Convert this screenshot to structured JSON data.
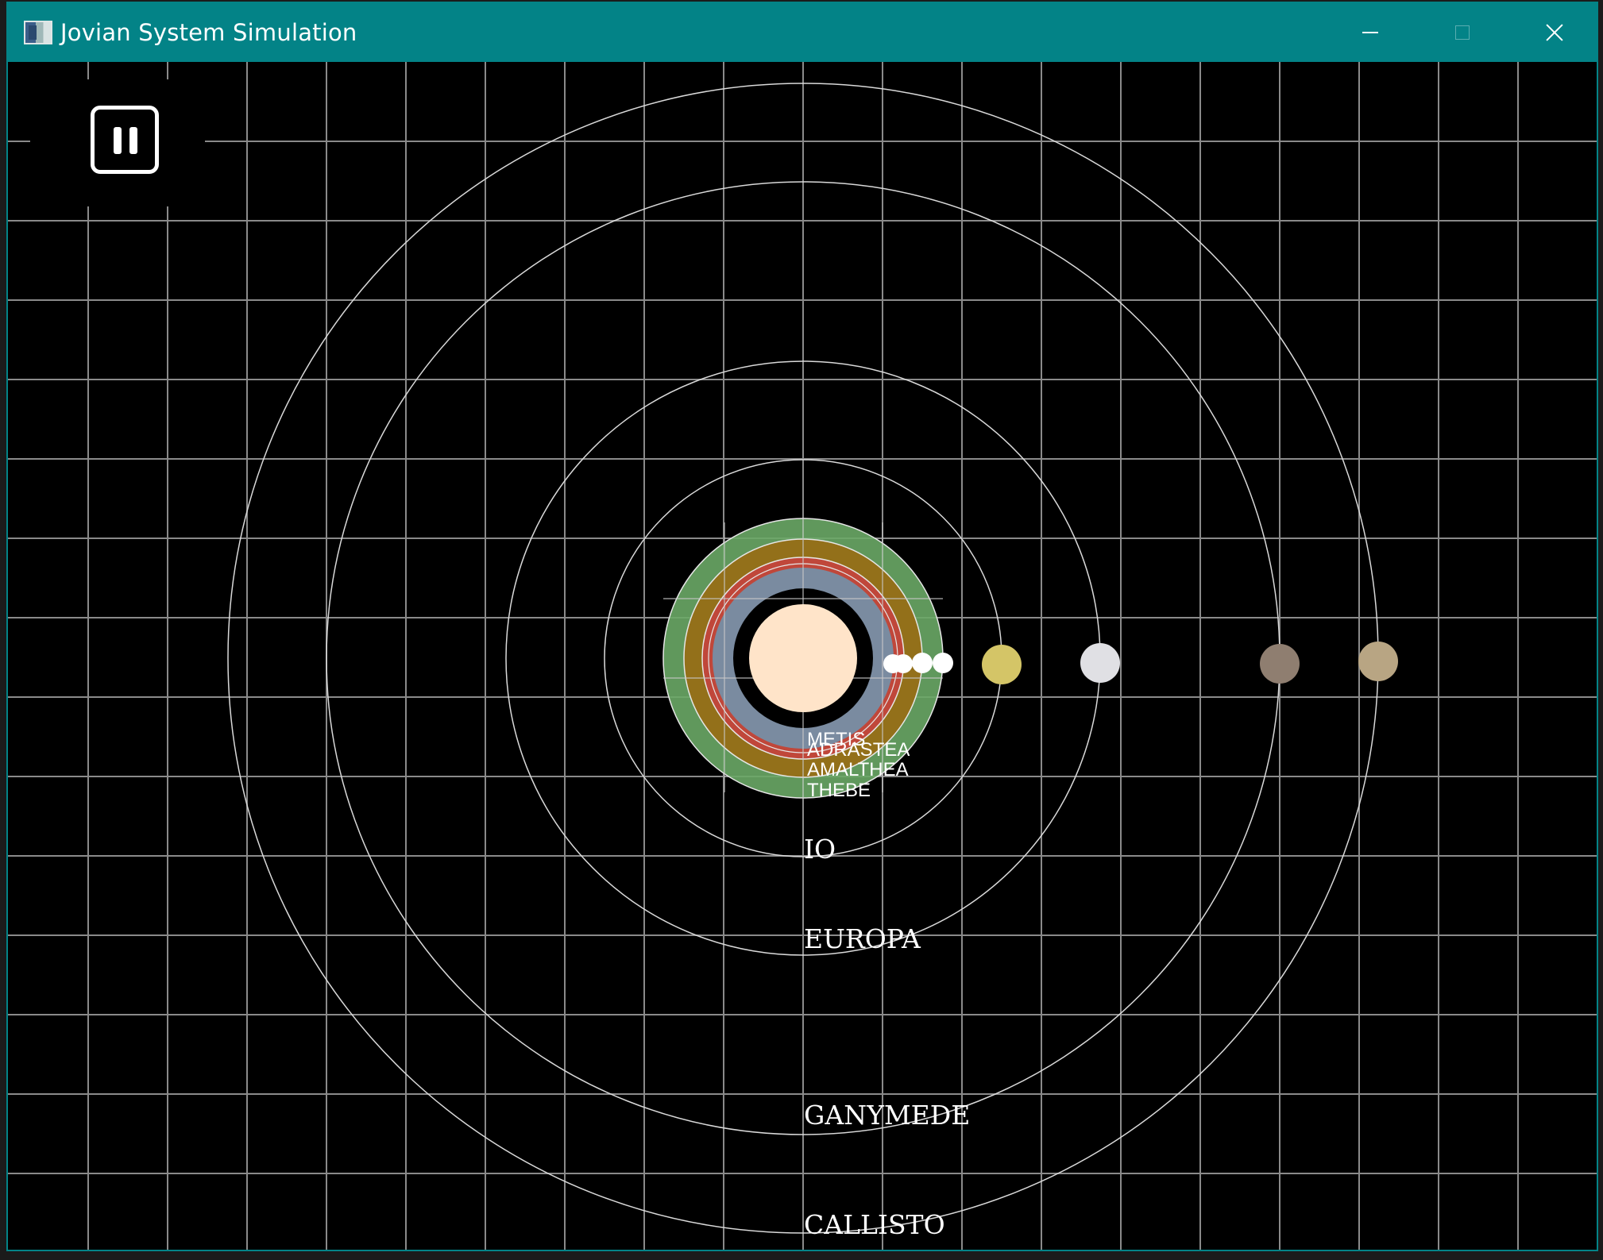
{
  "window": {
    "title": "Jovian System Simulation"
  },
  "titlebar_icons": {
    "app": "app-window-icon",
    "minimize": "minimize-icon",
    "maximize": "maximize-icon",
    "close": "close-icon"
  },
  "controls": {
    "pause_icon": "pause-icon"
  },
  "colors": {
    "titlebar": "#038387",
    "background": "#000000",
    "grid": "#8a8a8a",
    "orbit": "#d9d9d9",
    "jupiter": "#ffe4c9",
    "ring_green": "#6aa866",
    "ring_brown": "#93701a",
    "ring_red": "#c0473a",
    "ring_slate": "#7a8ba0"
  },
  "moons": [
    {
      "name": "METIS",
      "color": "#ffffff"
    },
    {
      "name": "ADRASTEA",
      "color": "#ffffff"
    },
    {
      "name": "AMALTHEA",
      "color": "#ffffff"
    },
    {
      "name": "THEBE",
      "color": "#ffffff"
    },
    {
      "name": "IO",
      "color": "#d4c567"
    },
    {
      "name": "EUROPA",
      "color": "#e0e0e4"
    },
    {
      "name": "GANYMEDE",
      "color": "#8f7e70"
    },
    {
      "name": "CALLISTO",
      "color": "#b8a583"
    }
  ]
}
